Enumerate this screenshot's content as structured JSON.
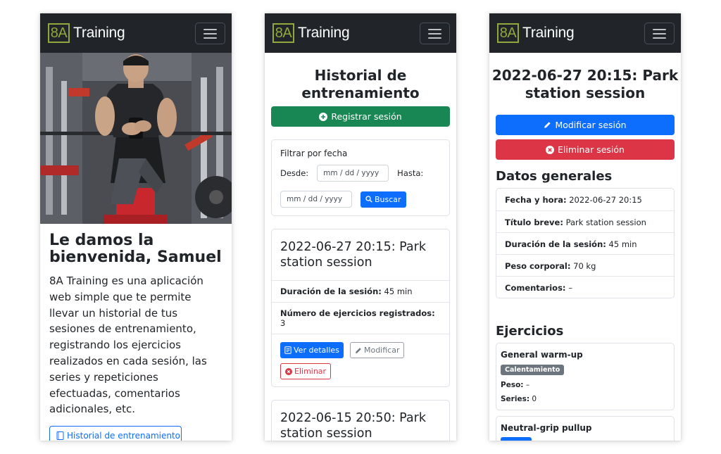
{
  "brand": {
    "logo": "8A",
    "name": "Training"
  },
  "home": {
    "welcome": "Le damos la bienvenida, Samuel",
    "intro": "8A Training es una aplicación web simple que te permite llevar un historial de tus sesiones de entrenamiento, registrando los ejercicios realizados en cada sesión, las series y repeticiones efectuadas, comentarios adicionales, etc.",
    "history_button": "Historial de entrenamiento"
  },
  "history": {
    "title": "Historial de entrenamiento",
    "register_button": "Registrar sesión",
    "filter": {
      "title": "Filtrar por fecha",
      "from_label": "Desde:",
      "to_label": "Hasta:",
      "date_placeholder": "mm / dd / yyyy",
      "search_button": "Buscar"
    },
    "sessions": [
      {
        "title": "2022-06-27 20:15: Park station session",
        "duration_label": "Duración de la sesión:",
        "duration": "45 min",
        "exercises_label": "Número de ejercicios registrados:",
        "exercises": "3",
        "view_button": "Ver detalles",
        "edit_button": "Modificar",
        "delete_button": "Eliminar"
      },
      {
        "title": "2022-06-15 20:50: Park station session"
      }
    ]
  },
  "detail": {
    "title": "2022-06-27 20:15: Park station session",
    "edit_button": "Modificar sesión",
    "delete_button": "Eliminar sesión",
    "general_title": "Datos generales",
    "fields": [
      {
        "label": "Fecha y hora:",
        "value": "2022-06-27 20:15"
      },
      {
        "label": "Título breve:",
        "value": "Park station session"
      },
      {
        "label": "Duración de la sesión:",
        "value": "45 min"
      },
      {
        "label": "Peso corporal:",
        "value": "70 kg"
      },
      {
        "label": "Comentarios:",
        "value": "–"
      }
    ],
    "exercises_title": "Ejercicios",
    "exercises": [
      {
        "name": "General warm-up",
        "badge": "Calentamiento",
        "weight_label": "Peso:",
        "weight": "–",
        "series_label": "Series:",
        "series": "0"
      },
      {
        "name": "Neutral-grip pullup"
      }
    ]
  },
  "colors": {
    "navbar": "#212529",
    "logo": "#93a83a",
    "primary": "#0d6efd",
    "success": "#198754",
    "danger": "#dc3545",
    "secondary": "#6c757d"
  }
}
